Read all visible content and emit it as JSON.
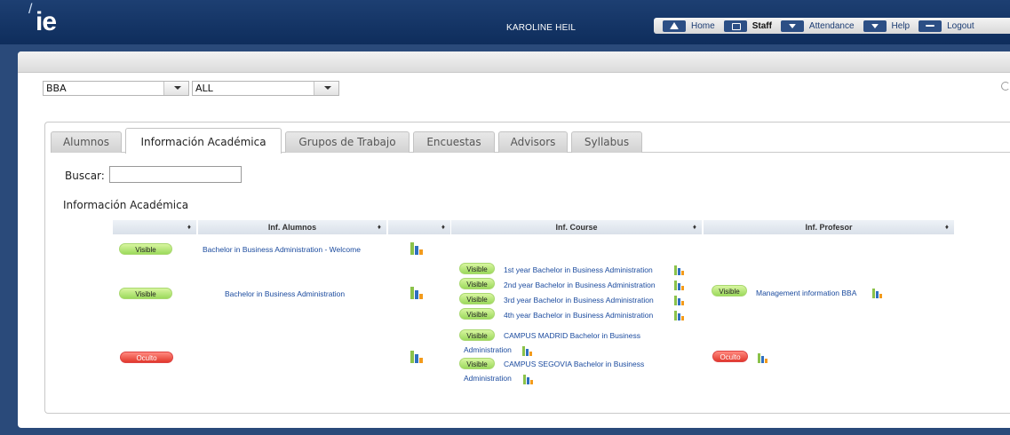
{
  "header": {
    "logo": "ie",
    "user_name": "KAROLINE HEIL",
    "nav": [
      {
        "label": "Home",
        "icon": "home-icon"
      },
      {
        "label": "Staff",
        "icon": "user-icon"
      },
      {
        "label": "Attendance",
        "icon": "chevron-down-icon"
      },
      {
        "label": "Help",
        "icon": "chevron-down-icon"
      },
      {
        "label": "Logout",
        "icon": "logout-arrow-icon"
      }
    ]
  },
  "filters": {
    "program": "BBA",
    "scope": "ALL"
  },
  "tabs": [
    {
      "label": "Alumnos",
      "active": false
    },
    {
      "label": "Información Académica",
      "active": true
    },
    {
      "label": "Grupos de Trabajo",
      "active": false
    },
    {
      "label": "Encuestas",
      "active": false
    },
    {
      "label": "Advisors",
      "active": false
    },
    {
      "label": "Syllabus",
      "active": false
    }
  ],
  "search": {
    "label": "Buscar:",
    "value": ""
  },
  "section_title": "Información Académica",
  "table": {
    "headers": [
      "",
      "Inf. Alumnos",
      "",
      "Inf. Course",
      "Inf. Profesor"
    ],
    "sort_glyph": "♦",
    "rows": [
      {
        "status": "Visible",
        "alumnos": "Bachelor in Business Administration - Welcome",
        "courses": [],
        "profesor": null
      },
      {
        "status": "Visible",
        "alumnos": "Bachelor in Business Administration",
        "courses": [
          {
            "status": "Visible",
            "name": "1st year Bachelor in Business Administration"
          },
          {
            "status": "Visible",
            "name": "2nd year Bachelor in Business Administration"
          },
          {
            "status": "Visible",
            "name": "3rd year Bachelor in Business Administration"
          },
          {
            "status": "Visible",
            "name": "4th year Bachelor in Business Administration"
          }
        ],
        "profesor": {
          "status": "Visible",
          "name": "Management information BBA"
        }
      },
      {
        "status": "Oculto",
        "alumnos": "",
        "courses": [
          {
            "status": "Visible",
            "name": "CAMPUS MADRID Bachelor in Business Administration"
          },
          {
            "status": "Visible",
            "name": "CAMPUS SEGOVIA Bachelor in Business Administration"
          }
        ],
        "profesor": {
          "status": "Oculto",
          "name": ""
        }
      }
    ]
  },
  "colors": {
    "header_bg": "#0e2d5c",
    "link": "#1a4a9e",
    "visible_pill": "#9cda5c",
    "oculto_pill": "#e2382c"
  }
}
